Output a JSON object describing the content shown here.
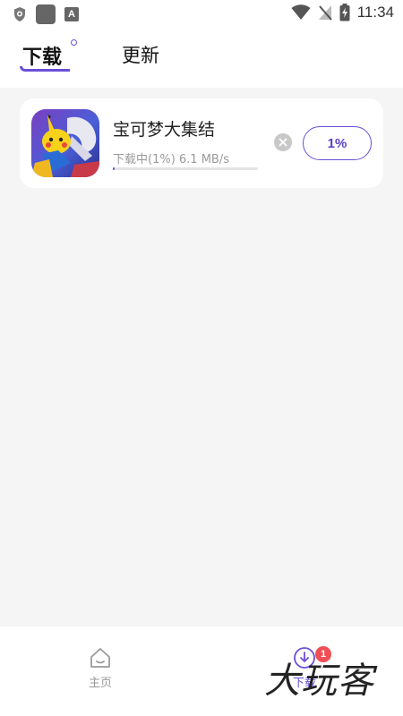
{
  "status_bar": {
    "time": "11:34",
    "app_badge_letter": "A"
  },
  "tabs": {
    "download": "下载",
    "update": "更新"
  },
  "download_item": {
    "name": "宝可梦大集结",
    "status": "下载中(1%) 6.1 MB/s",
    "progress_label": "1%",
    "progress": 0.01
  },
  "nav": {
    "home": "主页",
    "downloads": "下载",
    "downloads_badge": "1"
  },
  "watermark": "大玩客",
  "colors": {
    "accent": "#6b4fd8",
    "badge": "#ef4f55",
    "background": "#f5f5f5"
  }
}
